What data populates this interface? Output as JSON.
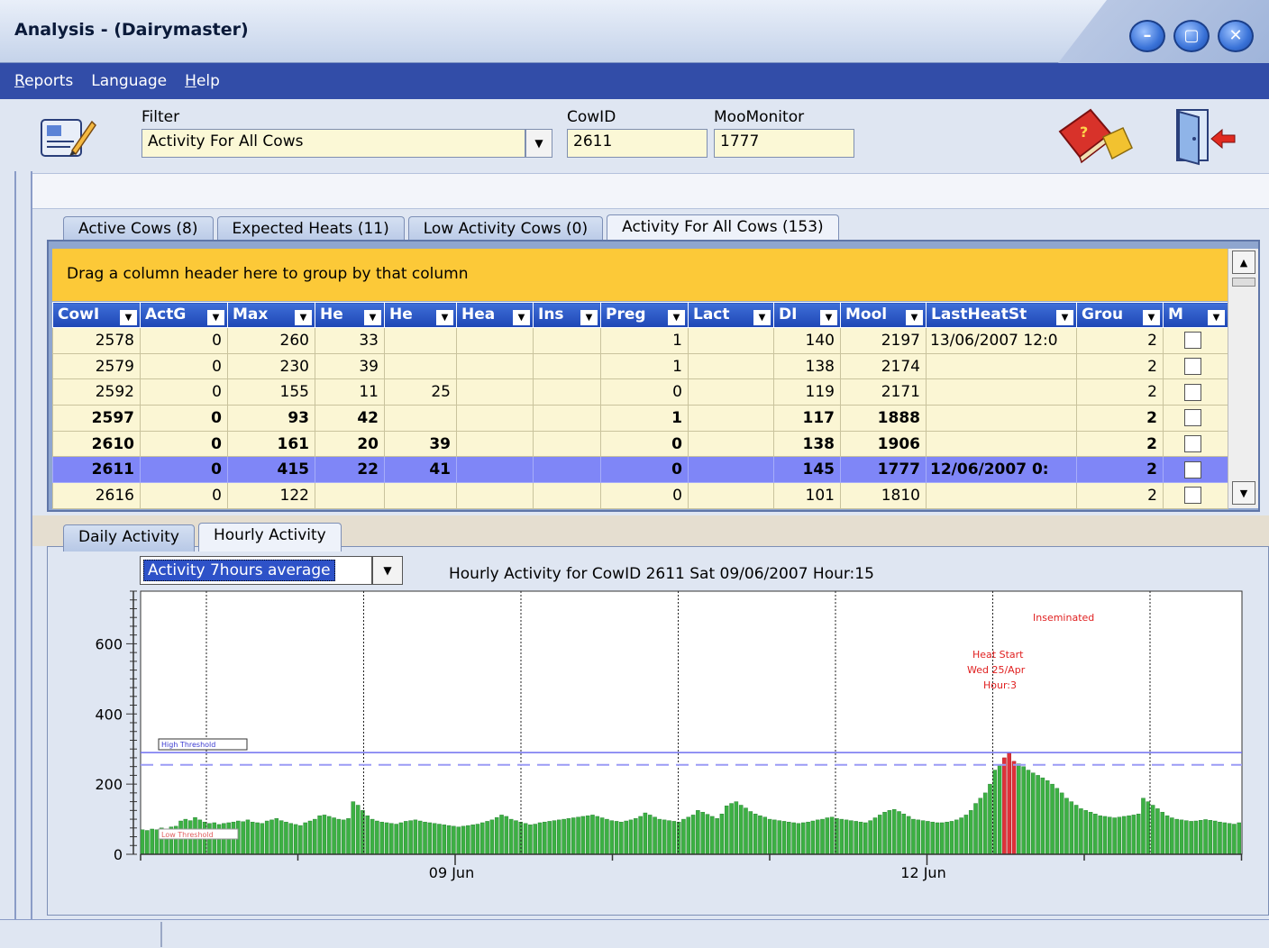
{
  "window": {
    "title": "Analysis - (Dairymaster)",
    "controls": [
      "–",
      "▢",
      "✕"
    ]
  },
  "menu": [
    "Reports",
    "Language",
    "Help"
  ],
  "toolbar": {
    "filter_label": "Filter",
    "filter_value": "Activity For All Cows",
    "cowid_label": "CowID",
    "cowid_value": "2611",
    "moomonitor_label": "MooMonitor",
    "moomonitor_value": "1777"
  },
  "tabs": [
    "Active Cows (8)",
    "Expected Heats (11)",
    "Low Activity Cows (0)",
    "Activity For All Cows (153)"
  ],
  "grid": {
    "group_hint": "Drag a column header here to group by that column",
    "columns": [
      "CowI",
      "ActG",
      "Max",
      "He",
      "He",
      "Hea",
      "Ins",
      "Preg",
      "Lact",
      "DI",
      "Mool",
      "LastHeatSt",
      "Grou",
      "M"
    ],
    "rows": [
      [
        "2578",
        "0",
        "260",
        "33",
        "",
        "",
        "",
        "1",
        "",
        "140",
        "2197",
        "13/06/2007 12:0",
        "2"
      ],
      [
        "2579",
        "0",
        "230",
        "39",
        "",
        "",
        "",
        "1",
        "",
        "138",
        "2174",
        "",
        "2"
      ],
      [
        "2592",
        "0",
        "155",
        "11",
        "25",
        "",
        "",
        "0",
        "",
        "119",
        "2171",
        "",
        "2"
      ],
      [
        "2597",
        "0",
        "93",
        "42",
        "",
        "",
        "",
        "1",
        "",
        "117",
        "1888",
        "",
        "2"
      ],
      [
        "2610",
        "0",
        "161",
        "20",
        "39",
        "",
        "",
        "0",
        "",
        "138",
        "1906",
        "",
        "2"
      ],
      [
        "2611",
        "0",
        "415",
        "22",
        "41",
        "",
        "",
        "0",
        "",
        "145",
        "1777",
        "12/06/2007 0:",
        "2"
      ],
      [
        "2616",
        "0",
        "122",
        "",
        "",
        "",
        "",
        "0",
        "",
        "101",
        "1810",
        "",
        "2"
      ]
    ],
    "bold_rows": [
      3,
      4
    ],
    "selected_row": 5
  },
  "subtabs": [
    "Daily Activity",
    "Hourly Activity"
  ],
  "chart_controls": {
    "combo_value": "Activity 7hours average",
    "chart_title": "Hourly Activity for CowID 2611 Sat 09/06/2007 Hour:15"
  },
  "chart_data": {
    "type": "bar",
    "title": "Hourly Activity for CowID 2611 Sat 09/06/2007 Hour:15",
    "ylim": [
      0,
      750
    ],
    "yticks": [
      0,
      200,
      400,
      600
    ],
    "xtick_labels": [
      "09 Jun",
      "12 Jun"
    ],
    "high_threshold": 290,
    "dashed_line": 255,
    "threshold_labels": [
      "High Threshold",
      "Low Threshold"
    ],
    "annotations": [
      "Inseminated",
      "Heat Start",
      "Wed 25/Apr",
      "Hour:3"
    ],
    "colors": {
      "bar": "#3cb043",
      "highlight": "#e0313a",
      "threshold": "#6f6ff0",
      "annotation": "#e02020"
    },
    "values": [
      70,
      68,
      72,
      70,
      75,
      72,
      78,
      80,
      95,
      100,
      96,
      105,
      98,
      92,
      88,
      90,
      85,
      88,
      90,
      92,
      95,
      93,
      98,
      92,
      90,
      88,
      95,
      98,
      102,
      96,
      92,
      88,
      85,
      82,
      90,
      95,
      100,
      110,
      112,
      108,
      104,
      100,
      98,
      102,
      150,
      140,
      125,
      110,
      100,
      95,
      92,
      90,
      88,
      86,
      90,
      94,
      96,
      98,
      95,
      92,
      90,
      88,
      86,
      84,
      82,
      80,
      78,
      80,
      82,
      84,
      86,
      90,
      94,
      98,
      105,
      112,
      108,
      100,
      96,
      92,
      88,
      84,
      86,
      90,
      92,
      94,
      96,
      98,
      100,
      102,
      104,
      106,
      108,
      110,
      112,
      108,
      104,
      100,
      96,
      94,
      92,
      95,
      98,
      102,
      108,
      118,
      112,
      106,
      100,
      98,
      96,
      94,
      92,
      100,
      106,
      112,
      125,
      120,
      114,
      108,
      102,
      115,
      138,
      145,
      150,
      140,
      132,
      122,
      115,
      110,
      106,
      100,
      98,
      96,
      94,
      92,
      90,
      88,
      90,
      92,
      95,
      98,
      100,
      104,
      106,
      102,
      100,
      98,
      96,
      94,
      92,
      90,
      96,
      104,
      112,
      120,
      125,
      128,
      122,
      115,
      108,
      100,
      98,
      96,
      94,
      92,
      90,
      90,
      92,
      94,
      98,
      104,
      112,
      125,
      145,
      160,
      175,
      200,
      240,
      255,
      275,
      290,
      265,
      258,
      250,
      240,
      232,
      225,
      218,
      210,
      200,
      188,
      175,
      160,
      150,
      140,
      130,
      125,
      120,
      115,
      110,
      108,
      106,
      104,
      106,
      108,
      110,
      112,
      115,
      160,
      150,
      140,
      130,
      120,
      110,
      104,
      100,
      98,
      96,
      94,
      95,
      97,
      99,
      97,
      95,
      92,
      90,
      88,
      86,
      90
    ],
    "highlight_indices": [
      180,
      181,
      182
    ]
  }
}
